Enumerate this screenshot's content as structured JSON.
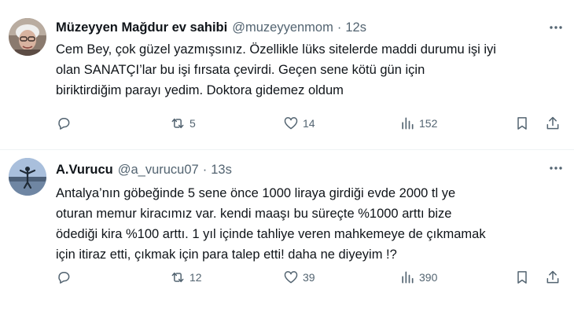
{
  "tweets": [
    {
      "name": "Müzeyyen Mağdur ev sahibi",
      "handle": "@muzeyyenmom",
      "separator": "·",
      "time": "12s",
      "avatar_icon": "avatar-elderly-woman",
      "text": "Cem Bey, çok güzel yazmışsınız. Özellikle lüks sitelerde maddi durumu işi iyi\nolan SANATÇI’lar bu işi fırsata çevirdi. Geçen sene kötü gün için\nbiriktirdiğim parayı yedim. Doktora gidemez oldum",
      "replies": "",
      "retweets": "5",
      "likes": "14",
      "views": "152"
    },
    {
      "name": "A.Vurucu",
      "handle": "@a_vurucu07",
      "separator": "·",
      "time": "13s",
      "avatar_icon": "avatar-person-by-lake",
      "text": "Antalya’nın göbeğinde 5 sene önce 1000 liraya girdiği evde 2000 tl ye\noturan memur kiracımız var. kendi maaşı bu süreçte %1000 arttı bize\nödediği kira %100 arttı. 1 yıl içinde tahliye veren mahkemeye de çıkmamak\niçin itiraz etti, çıkmak için para talep etti! daha ne diyeyim !?",
      "replies": "",
      "retweets": "12",
      "likes": "39",
      "views": "390"
    }
  ],
  "colors": {
    "text": "#0f1419",
    "secondary": "#536471",
    "divider": "#eff3f4",
    "background": "#ffffff"
  }
}
